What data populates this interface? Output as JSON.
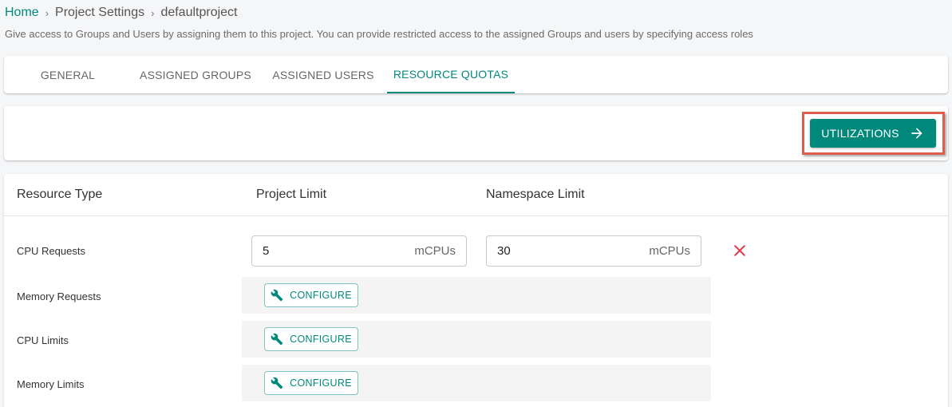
{
  "breadcrumb": {
    "home": "Home",
    "separator": "›",
    "items": [
      "Project Settings",
      "defaultproject"
    ]
  },
  "subtitle": "Give access to Groups and Users by assigning them to this project. You can provide restricted access to the assigned Groups and users by specifying access roles",
  "tabs": [
    {
      "label": "GENERAL",
      "active": false
    },
    {
      "label": "ASSIGNED GROUPS",
      "active": false
    },
    {
      "label": "ASSIGNED USERS",
      "active": false
    },
    {
      "label": "RESOURCE QUOTAS",
      "active": true
    }
  ],
  "toolbar": {
    "utilizations_label": "UTILIZATIONS",
    "utilizations_icon": "arrow-right-icon"
  },
  "table": {
    "headers": [
      "Resource Type",
      "Project Limit",
      "Namespace Limit"
    ],
    "rows": [
      {
        "resource": "CPU Requests",
        "project_limit": "5",
        "project_unit": "mCPUs",
        "namespace_limit": "30",
        "namespace_unit": "mCPUs",
        "delete_icon": "close-icon"
      },
      {
        "resource": "Memory Requests",
        "configure_label": "CONFIGURE",
        "configure_icon": "wrench-icon"
      },
      {
        "resource": "CPU Limits",
        "configure_label": "CONFIGURE",
        "configure_icon": "wrench-icon"
      },
      {
        "resource": "Memory Limits",
        "configure_label": "CONFIGURE",
        "configure_icon": "wrench-icon"
      }
    ]
  },
  "colors": {
    "accent": "#00897b",
    "highlight": "#e05c4d",
    "delete": "#e8334a"
  }
}
